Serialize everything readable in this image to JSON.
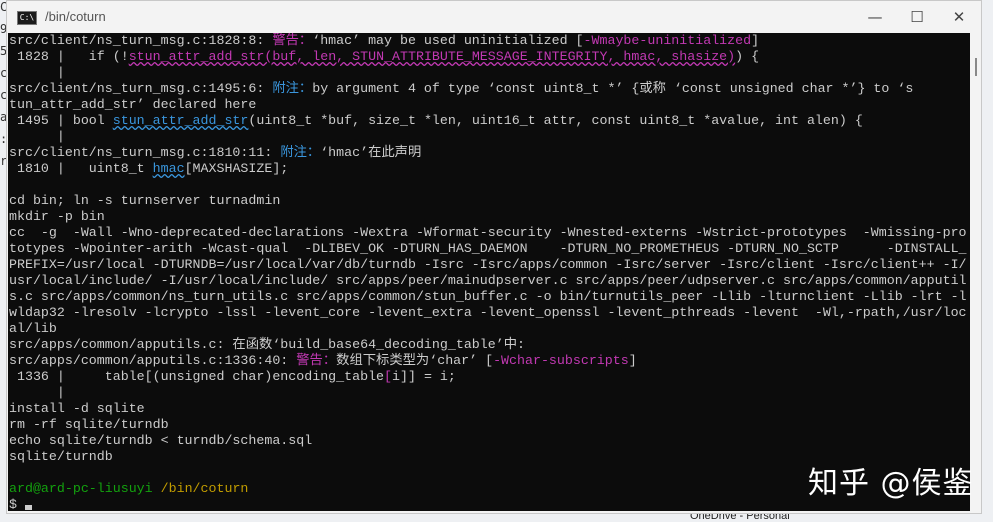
{
  "window": {
    "title": "/bin/coturn",
    "icon_label": "C:\\",
    "controls": {
      "minimize": "—",
      "maximize": "☐",
      "close": "✕"
    }
  },
  "terminal_lines": [
    [
      {
        "t": "src/client/ns_turn_msg.c:1828:8: "
      },
      {
        "t": "警告：",
        "c": "warn"
      },
      {
        "t": "‘hmac’ may be used uninitialized ["
      },
      {
        "t": "-Wmaybe-uninitialized",
        "c": "warn"
      },
      {
        "t": "]"
      }
    ],
    [
      {
        "t": " 1828 |   if (!"
      },
      {
        "t": "stun_attr_add_str(buf, len, STUN_ATTRIBUTE_MESSAGE_INTEGRITY, hmac, shasize)",
        "c": "warn sq"
      },
      {
        "t": ") {"
      }
    ],
    [
      {
        "t": "      |"
      }
    ],
    [
      {
        "t": "src/client/ns_turn_msg.c:1495:6: "
      },
      {
        "t": "附注：",
        "c": "note"
      },
      {
        "t": "by argument 4 of type ‘const uint8_t *’ {或称 ‘const unsigned char *’} to ‘s"
      }
    ],
    [
      {
        "t": "tun_attr_add_str’ declared here"
      }
    ],
    [
      {
        "t": " 1495 | bool "
      },
      {
        "t": "stun_attr_add_str",
        "c": "note sqn"
      },
      {
        "t": "(uint8_t *buf, size_t *len, uint16_t attr, const uint8_t *avalue, int alen) {"
      }
    ],
    [
      {
        "t": "      |"
      }
    ],
    [
      {
        "t": "src/client/ns_turn_msg.c:1810:11: "
      },
      {
        "t": "附注：",
        "c": "note"
      },
      {
        "t": "‘hmac’在此声明"
      }
    ],
    [
      {
        "t": " 1810 |   uint8_t "
      },
      {
        "t": "hmac",
        "c": "note sqn"
      },
      {
        "t": "[MAXSHASIZE];"
      }
    ],
    [
      {
        "t": ""
      }
    ],
    [
      {
        "t": "cd bin; ln -s turnserver turnadmin"
      }
    ],
    [
      {
        "t": "mkdir -p bin"
      }
    ],
    [
      {
        "t": "cc  -g  -Wall -Wno-deprecated-declarations -Wextra -Wformat-security -Wnested-externs -Wstrict-prototypes  -Wmissing-pro"
      }
    ],
    [
      {
        "t": "totypes -Wpointer-arith -Wcast-qual  -DLIBEV_OK -DTURN_HAS_DAEMON    -DTURN_NO_PROMETHEUS -DTURN_NO_SCTP      -DINSTALL_"
      }
    ],
    [
      {
        "t": "PREFIX=/usr/local -DTURNDB=/usr/local/var/db/turndb -Isrc -Isrc/apps/common -Isrc/server -Isrc/client -Isrc/client++ -I/"
      }
    ],
    [
      {
        "t": "usr/local/include/ -I/usr/local/include/ src/apps/peer/mainudpserver.c src/apps/peer/udpserver.c src/apps/common/apputil"
      }
    ],
    [
      {
        "t": "s.c src/apps/common/ns_turn_utils.c src/apps/common/stun_buffer.c -o bin/turnutils_peer -Llib -lturnclient -Llib -lrt -l"
      }
    ],
    [
      {
        "t": "wldap32 -lresolv -lcrypto -lssl -levent_core -levent_extra -levent_openssl -levent_pthreads -levent  -Wl,-rpath,/usr/loc"
      }
    ],
    [
      {
        "t": "al/lib"
      }
    ],
    [
      {
        "t": "src/apps/common/apputils.c: 在函数‘build_base64_decoding_table’中:"
      }
    ],
    [
      {
        "t": "src/apps/common/apputils.c:1336:40: "
      },
      {
        "t": "警告：",
        "c": "warn"
      },
      {
        "t": "数组下标类型为‘char’ ["
      },
      {
        "t": "-Wchar-subscripts",
        "c": "warn"
      },
      {
        "t": "]"
      }
    ],
    [
      {
        "t": " 1336 |     table[(unsigned char)encoding_table"
      },
      {
        "t": "[",
        "c": "warn"
      },
      {
        "t": "i]] = i;"
      }
    ],
    [
      {
        "t": "      |"
      }
    ],
    [
      {
        "t": "install -d sqlite"
      }
    ],
    [
      {
        "t": "rm -rf sqlite/turndb"
      }
    ],
    [
      {
        "t": "echo sqlite/turndb < turndb/schema.sql"
      }
    ],
    [
      {
        "t": "sqlite/turndb"
      }
    ],
    [
      {
        "t": ""
      }
    ],
    [
      {
        "t": "ard@ard-pc-liusuyi",
        "c": "green"
      },
      {
        "t": " "
      },
      {
        "t": "/bin/coturn",
        "c": "yellow"
      }
    ],
    [
      {
        "t": "$ "
      }
    ]
  ],
  "watermark": "知乎 @侯鉴",
  "background": {
    "left_edge_chars": "C\n9\n5\nc\nc\na\n:\nr",
    "taskbar_item": "OneDrive - Personal"
  }
}
